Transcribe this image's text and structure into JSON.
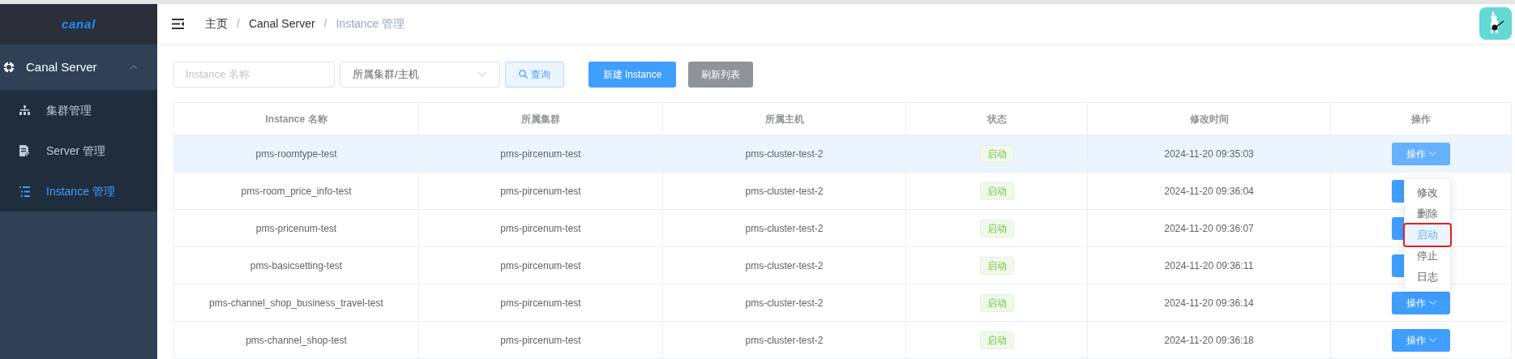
{
  "sidebar": {
    "logo": "canal",
    "group": {
      "label": "Canal Server",
      "expanded": true
    },
    "items": [
      {
        "label": "集群管理",
        "selected": false
      },
      {
        "label": "Server 管理",
        "selected": false
      },
      {
        "label": "Instance 管理",
        "selected": true
      }
    ]
  },
  "breadcrumb": [
    {
      "label": "主页"
    },
    {
      "separator": "/",
      "label": "Canal Server"
    },
    {
      "separator": "/",
      "label": "Instance 管理"
    }
  ],
  "toolbar": {
    "search_placeholder": "Instance 名称",
    "select_placeholder": "所属集群/主机",
    "query": "查询",
    "create": "新建 Instance",
    "refresh": "刷新列表"
  },
  "table": {
    "columns": [
      "Instance 名称",
      "所属集群",
      "所属主机",
      "状态",
      "修改时间",
      "操作"
    ],
    "rows": [
      {
        "name": "pms-roomtype-test",
        "cluster": "pms-pircenum-test",
        "host": "pms-cluster-test-2",
        "status": "启动",
        "time": "2024-11-20 09:35:03",
        "action": "操作",
        "selected": true
      },
      {
        "name": "pms-room_price_info-test",
        "cluster": "pms-pircenum-test",
        "host": "pms-cluster-test-2",
        "status": "启动",
        "time": "2024-11-20 09:36:04",
        "selected": false
      },
      {
        "name": "pms-pricenum-test",
        "cluster": "pms-pircenum-test",
        "host": "pms-cluster-test-2",
        "status": "启动",
        "time": "2024-11-20 09:36:07",
        "selected": false
      },
      {
        "name": "pms-basicsetting-test",
        "cluster": "pms-pircenum-test",
        "host": "pms-cluster-test-2",
        "status": "启动",
        "time": "2024-11-20 09:36:11",
        "selected": false
      },
      {
        "name": "pms-channel_shop_business_travel-test",
        "cluster": "pms-pircenum-test",
        "host": "pms-cluster-test-2",
        "status": "启动",
        "time": "2024-11-20 09:36:14",
        "action": "操作",
        "selected": false
      },
      {
        "name": "pms-channel_shop-test",
        "cluster": "pms-pircenum-test",
        "host": "pms-cluster-test-2",
        "status": "启动",
        "time": "2024-11-20 09:36:18",
        "action": "操作",
        "selected": false
      }
    ]
  },
  "dropdown": [
    {
      "label": "修改",
      "highlighted": false
    },
    {
      "label": "删除",
      "highlighted": false
    },
    {
      "label": "启动",
      "highlighted": true
    },
    {
      "label": "停止",
      "highlighted": false
    },
    {
      "label": "日志",
      "highlighted": false
    }
  ]
}
